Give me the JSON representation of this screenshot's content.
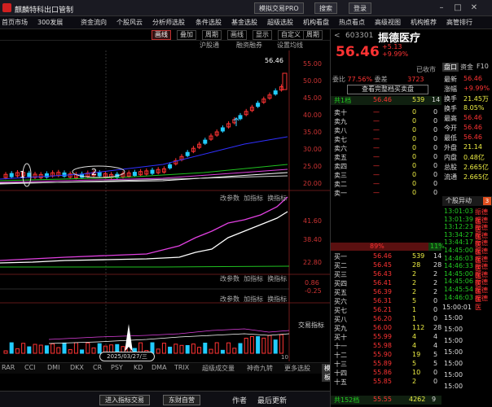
{
  "titlebar": {
    "title": "麒麟特科出口管制",
    "btn_trade": "模拟交易PRO",
    "btn_search": "搜索",
    "btn_user": "登录"
  },
  "menu": [
    "首页市场",
    "300发展",
    "资金流向",
    "个股风云",
    "分析师选股",
    "条件选股",
    "基金选股",
    "超级选股",
    "机构看盘",
    "热点看点",
    "高级视图",
    "机构推荐",
    "高管排行"
  ],
  "chart_toolbar": [
    "画线",
    "叠加",
    "周期",
    "画线",
    "显示",
    "自定义",
    "周期"
  ],
  "chart_toolbar_active": 0,
  "subheader": [
    "沪股通",
    "融资融券",
    "设置均线"
  ],
  "main": {
    "top_tag": "56.46",
    "y_labels": [
      "55.00",
      "50.00",
      "45.00",
      "40.00",
      "35.00",
      "30.00",
      "25.00",
      "20.00"
    ],
    "label_1": "1",
    "label_2": "2"
  },
  "panel2": {
    "hdr": [
      "改参数",
      "加指标",
      "换指标"
    ],
    "y_labels": [
      "41.60",
      "38.40",
      "22.80"
    ]
  },
  "panel3": {
    "hdr": [
      "改参数",
      "加指标",
      "换指标"
    ],
    "y_labels": [
      "0.86",
      "-0.25"
    ]
  },
  "panel4": {
    "hdr": [
      "改参数",
      "加指标",
      "换指标"
    ],
    "y_labels": [
      "交易指标"
    ],
    "date_label": "2025/03/27/三",
    "x_right": "10"
  },
  "ind_tabs": [
    "RAR",
    "CCI",
    "DMI",
    "DKX",
    "CR",
    "PSY",
    "KD",
    "DMA",
    "TRIX",
    "超级成交量",
    "神奇九转",
    "更多选股",
    "模板"
  ],
  "ind_tab_selected": 12,
  "bottombar": {
    "btn1": "进入指标交易",
    "btn2": "东财自营",
    "btn3": "作者",
    "btn4": "最后更新"
  },
  "quote": {
    "code": "603301",
    "name": "振德医疗",
    "price": "56.46",
    "chg": "+5.13",
    "pct": "+9.99%",
    "badge": "已收市",
    "weibi_label": "委比",
    "weibi_val": "77.56%",
    "weicha_label": "委差",
    "weicha_val": "3723",
    "tip": "查看完整档买卖盘",
    "sell_levels": [
      [
        "卖十",
        "—",
        "0",
        "0"
      ],
      [
        "卖九",
        "—",
        "0",
        "0"
      ],
      [
        "卖八",
        "—",
        "0",
        "0"
      ],
      [
        "卖七",
        "—",
        "0",
        "0"
      ],
      [
        "卖六",
        "—",
        "0",
        "0"
      ],
      [
        "卖五",
        "—",
        "0",
        "0"
      ],
      [
        "卖四",
        "—",
        "0",
        "0"
      ],
      [
        "卖三",
        "—",
        "0",
        "0"
      ],
      [
        "卖二",
        "—",
        "0",
        "0"
      ],
      [
        "卖一",
        "—",
        "0",
        "0"
      ]
    ],
    "buy_levels": [
      [
        "买一",
        "56.46",
        "539",
        "14"
      ],
      [
        "买二",
        "56.45",
        "28",
        "28"
      ],
      [
        "买三",
        "56.43",
        "2",
        "2"
      ],
      [
        "买四",
        "56.41",
        "2",
        "2"
      ],
      [
        "买五",
        "56.39",
        "2",
        "2"
      ],
      [
        "买六",
        "56.31",
        "5",
        "0"
      ],
      [
        "买七",
        "56.21",
        "1",
        "0"
      ],
      [
        "买八",
        "56.20",
        "1",
        "0"
      ],
      [
        "买九",
        "56.00",
        "112",
        "28"
      ],
      [
        "买十",
        "55.99",
        "4",
        "4"
      ],
      [
        "十一",
        "55.98",
        "4",
        "4"
      ],
      [
        "十二",
        "55.90",
        "19",
        "5"
      ],
      [
        "十三",
        "55.89",
        "5",
        "5"
      ],
      [
        "十四",
        "55.86",
        "10",
        "0"
      ],
      [
        "十五",
        "55.85",
        "2",
        "0"
      ]
    ],
    "total_label": "共1档",
    "total_price": "56.46",
    "total_vol": "539",
    "total_n": "14",
    "bar_pct_buy": "89%",
    "bar_pct_sell": "11%",
    "bottom_total_label": "共152档",
    "bottom_total_price": "55.55",
    "bottom_total_vol": "4262",
    "bottom_total_n": "9"
  },
  "right_tabs": [
    "盘口",
    "资金",
    "F10"
  ],
  "right_stats": [
    [
      "最新",
      "56.46"
    ],
    [
      "涨幅",
      "+9.99%"
    ],
    [
      "换手",
      "21.45万"
    ],
    [
      "换手",
      "8.05%"
    ],
    [
      "最高",
      "56.46"
    ],
    [
      "今开",
      "56.46"
    ],
    [
      "最低",
      "56.46"
    ],
    [
      "外盘",
      "21.14"
    ],
    [
      "内盘",
      "0.48亿"
    ],
    [
      "总股",
      "2.665亿"
    ],
    [
      "流通",
      "2.665亿"
    ]
  ],
  "right_sections": {
    "anomaly": "个股异动",
    "anomaly_badge": "3",
    "events": [
      [
        "13:01:03",
        "振德医"
      ],
      [
        "13:01:39",
        "振德医"
      ],
      [
        "13:12:23",
        "振德医"
      ],
      [
        "13:34:27",
        "振德医"
      ],
      [
        "13:44:17",
        "振德医"
      ],
      [
        "14:45:00",
        "振德医"
      ],
      [
        "14:46:03",
        "振德医"
      ],
      [
        "14:46:33",
        "振德医"
      ],
      [
        "14:45:00",
        "振德医"
      ],
      [
        "14:45:06",
        "振德医"
      ],
      [
        "14:45:54",
        "振德医"
      ],
      [
        "14:46:03",
        "振德医"
      ]
    ],
    "time_chart_label": "15:00:01",
    "time_chart_rows": [
      "15:00",
      "15:00",
      "15:00",
      "15:00",
      "15:00",
      "15:00",
      "15:00"
    ]
  },
  "colors": {
    "up": "#ff3333",
    "down": "#22cc22",
    "ma1": "#ffffff",
    "ma2": "#d4d4d4",
    "ma3": "#e040e0",
    "ma4": "#3030ff",
    "ma5": "#20c020"
  }
}
